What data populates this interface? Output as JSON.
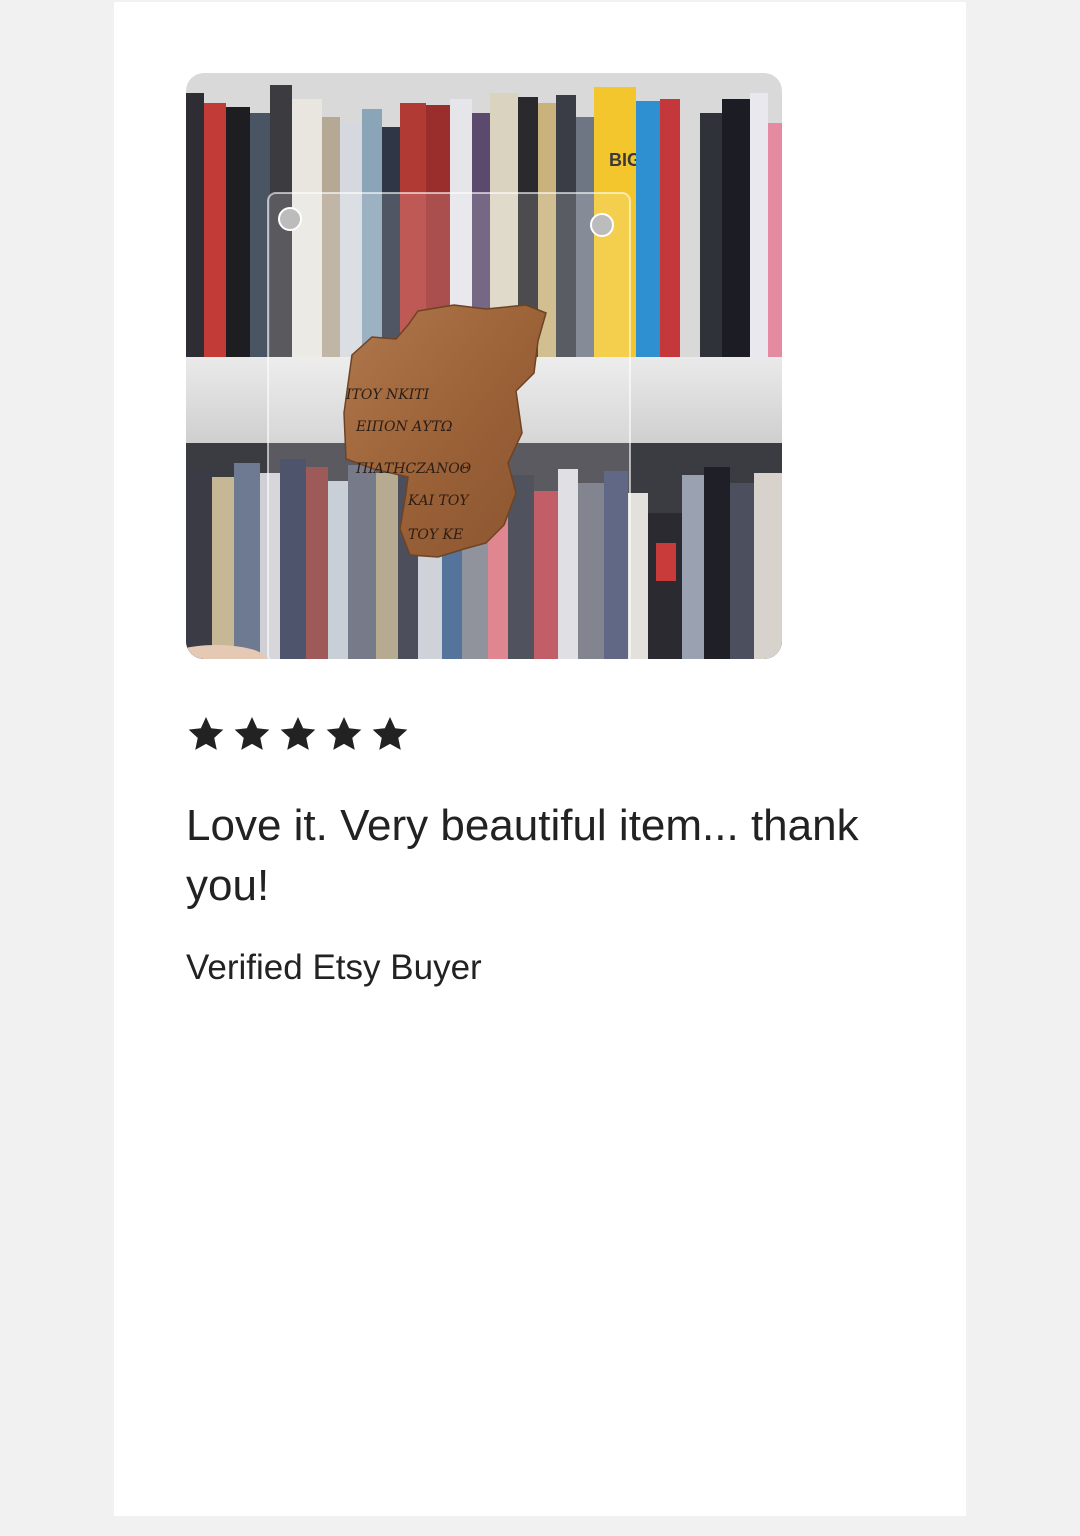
{
  "review": {
    "rating": 5,
    "max_rating": 5,
    "star_icon": "star-filled-icon",
    "text": "Love it. Very beautiful item... thank you!",
    "reviewer": "Verified Etsy Buyer",
    "photo": {
      "book_spine_text": "BIG",
      "papyrus_lines": [
        "ΙΤΟΥ ΝΚΙΤΙ",
        "ΕΙΠΟΝ ΑΥΤΩ",
        "ΠΙΑΤΗCΖΑΝΟΘ",
        "ΚΑΙ ΤΟΥ",
        "ΤΟΥ ΚΕ"
      ]
    }
  },
  "colors": {
    "page_background": "#f1f1f1",
    "card_background": "#ffffff",
    "text": "#222222",
    "star": "#222222"
  }
}
